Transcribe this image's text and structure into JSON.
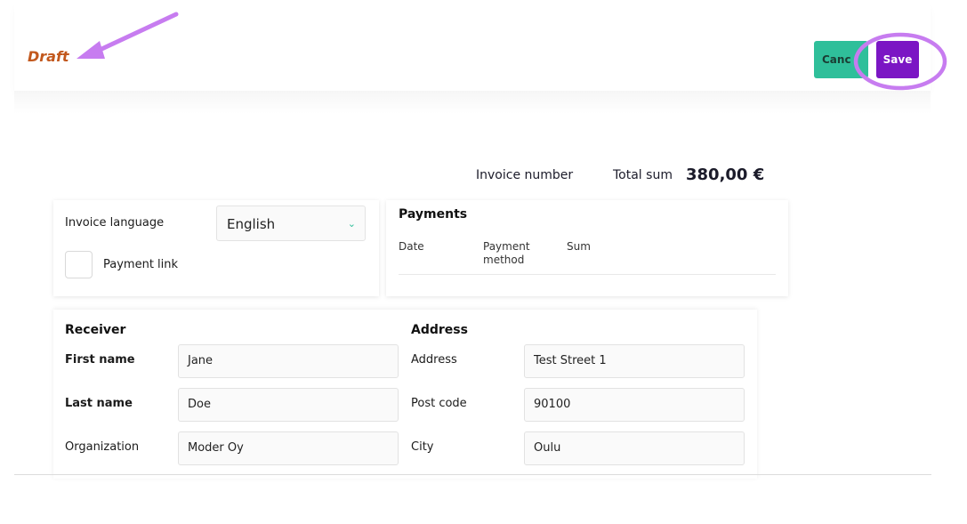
{
  "status": {
    "label": "Draft"
  },
  "actions": {
    "cancel_label": "Canc l",
    "save_label": "Save"
  },
  "summary": {
    "invoice_number_label": "Invoice number",
    "total_sum_label": "Total sum",
    "total_sum_value": "380,00 €"
  },
  "settings": {
    "language_label": "Invoice language",
    "language_value": "English",
    "payment_link_label": "Payment link"
  },
  "payments": {
    "title": "Payments",
    "columns": [
      "Date",
      "Payment method",
      "Sum"
    ]
  },
  "receiver": {
    "title": "Receiver",
    "fields": [
      {
        "label": "First name",
        "value": "Jane"
      },
      {
        "label": "Last name",
        "value": "Doe"
      },
      {
        "label": "Organization",
        "value": "Moder Oy"
      }
    ]
  },
  "address": {
    "title": "Address",
    "fields": [
      {
        "label": "Address",
        "value": "Test Street 1"
      },
      {
        "label": "Post code",
        "value": "90100"
      },
      {
        "label": "City",
        "value": "Oulu"
      }
    ]
  },
  "colors": {
    "draft": "#c2581d",
    "cancel_button": "#2fbf9a",
    "save_button": "#7b16c4",
    "annotation": "#c77cf0"
  },
  "icons": {
    "language_dropdown": "chevron-down-icon",
    "annotation_arrow": "arrow-annotation",
    "annotation_circle": "circle-annotation"
  }
}
